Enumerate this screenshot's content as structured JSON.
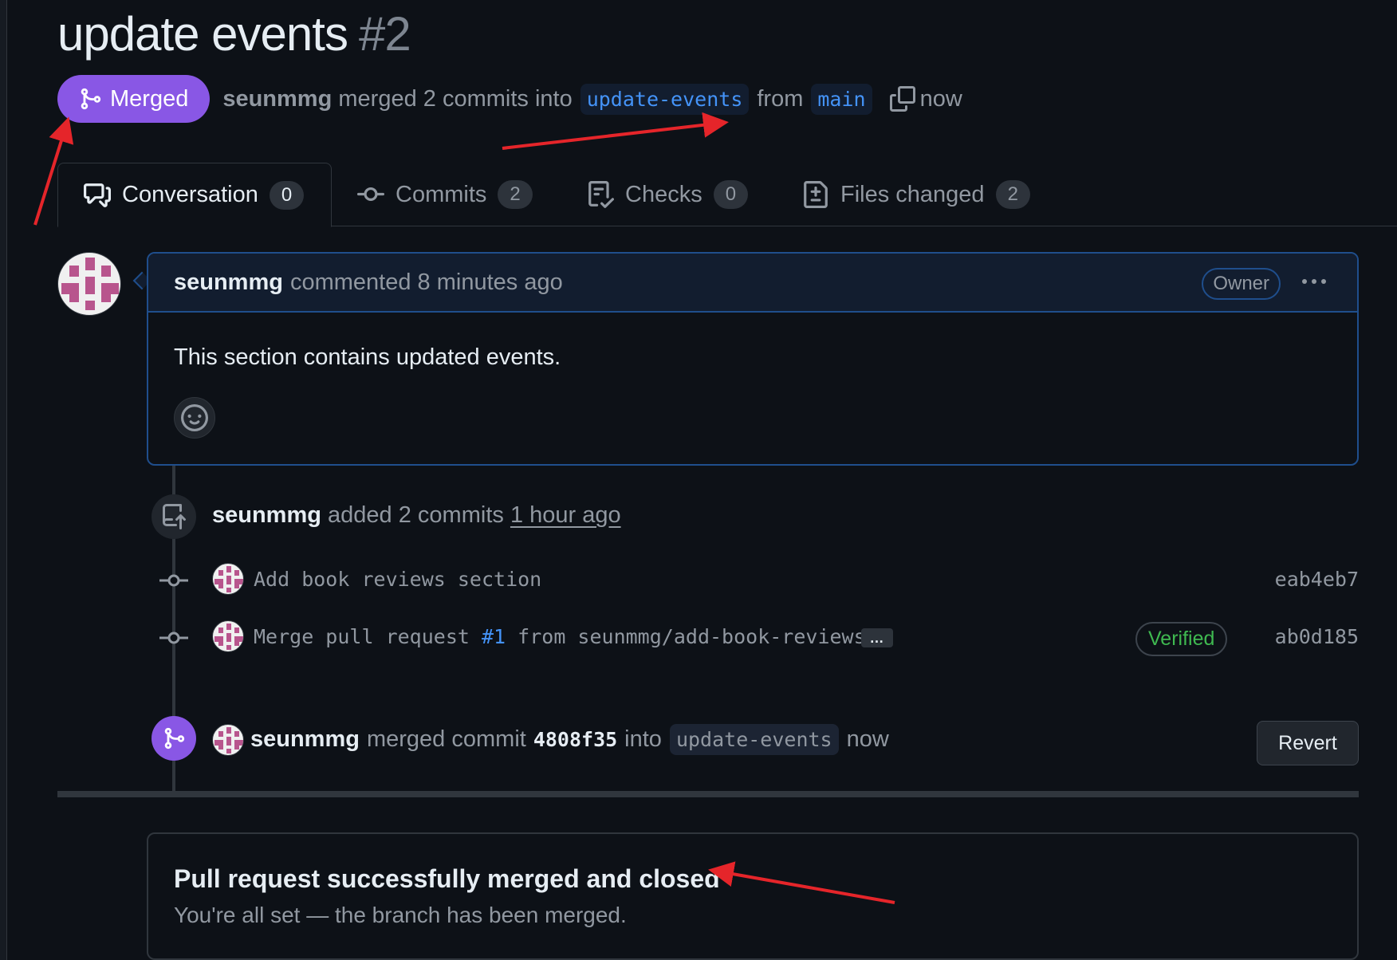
{
  "pr": {
    "title": "update events",
    "number": "#2",
    "status_label": "Merged",
    "author": "seunmmg",
    "merged_text": "merged 2 commits into",
    "base_branch": "update-events",
    "from_text": "from",
    "head_branch": "main",
    "time": "now"
  },
  "tabs": [
    {
      "label": "Conversation",
      "count": "0",
      "icon": "comment-discussion-icon"
    },
    {
      "label": "Commits",
      "count": "2",
      "icon": "git-commit-icon"
    },
    {
      "label": "Checks",
      "count": "0",
      "icon": "checklist-icon"
    },
    {
      "label": "Files changed",
      "count": "2",
      "icon": "file-diff-icon"
    }
  ],
  "comment": {
    "author": "seunmmg",
    "action": "commented 8 minutes ago",
    "role_badge": "Owner",
    "body": "This section contains updated events."
  },
  "added_commits": {
    "author": "seunmmg",
    "action": "added 2 commits",
    "time": "1 hour ago",
    "commits": [
      {
        "message": "Add book reviews section",
        "sha": "eab4eb7"
      },
      {
        "message_prefix": "Merge pull request",
        "pr_link": "#1",
        "message_suffix": "from seunmmg/add-book-reviews",
        "ellipsis": "…",
        "badge": "Verified",
        "sha": "ab0d185"
      }
    ]
  },
  "merge_event": {
    "author": "seunmmg",
    "action": "merged commit",
    "sha": "4808f35",
    "into_text": "into",
    "branch": "update-events",
    "time": "now",
    "revert_label": "Revert"
  },
  "merge_status": {
    "title": "Pull request successfully merged and closed",
    "subtitle": "You're all set — the branch has been merged."
  },
  "colors": {
    "background": "#0d1117",
    "merged_purple": "#8957e5",
    "link_blue": "#4493f8",
    "verified_green": "#3fb950",
    "annotation_red": "#e5252a"
  }
}
